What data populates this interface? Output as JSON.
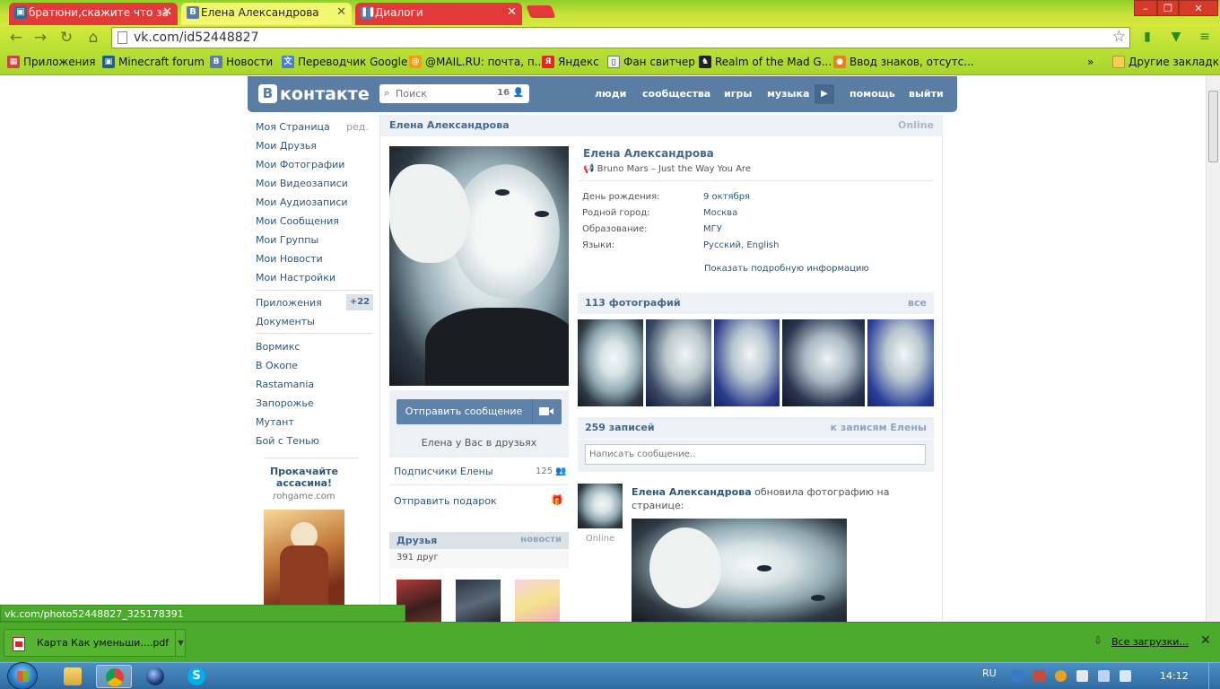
{
  "browser": {
    "tabs": [
      {
        "title": "братюни,скажите что за",
        "active": false
      },
      {
        "title": "Елена Александрова",
        "active": true
      },
      {
        "title": "Диалоги",
        "active": false
      }
    ],
    "url": "vk.com/id52448827",
    "bookmarks": [
      {
        "label": "Приложения",
        "icon": "apps-icon"
      },
      {
        "label": "Minecraft forum",
        "icon": "minecraft-icon"
      },
      {
        "label": "Новости",
        "icon": "vk-icon"
      },
      {
        "label": "Переводчик Google",
        "icon": "translate-icon"
      },
      {
        "label": "@MAIL.RU: почта, п...",
        "icon": "mailru-icon"
      },
      {
        "label": "Яндекс",
        "icon": "yandex-icon"
      },
      {
        "label": "Фан свитчер",
        "icon": "page-icon"
      },
      {
        "label": "Realm of the Mad G...",
        "icon": "realm-icon"
      },
      {
        "label": "Ввод знаков, отсутс...",
        "icon": "apple-icon"
      }
    ],
    "bookmarks_more": "»",
    "other_bookmarks": "Другие закладки",
    "status_url": "vk.com/photo52448827_325178391"
  },
  "vk": {
    "logo": "контакте",
    "logo_letter": "В",
    "search": {
      "placeholder": "Поиск",
      "count": "16"
    },
    "nav": [
      "люди",
      "сообщества",
      "игры",
      "музыка",
      "помощь",
      "выйти"
    ],
    "left_menu": [
      "Моя Страница",
      "Мои Друзья",
      "Мои Фотографии",
      "Мои Видеозаписи",
      "Мои Аудиозаписи",
      "Мои Сообщения",
      "Мои Группы",
      "Мои Новости",
      "Мои Настройки"
    ],
    "edit_label": "ред.",
    "apps_menu": [
      "Приложения",
      "Документы"
    ],
    "apps_badge": "+22",
    "app_links": [
      "Вормикс",
      "В Окопе",
      "Rastamania",
      "Запорожье",
      "Мутант",
      "Бой с Тенью"
    ],
    "ad": {
      "title": "Прокачайте ассасина!",
      "site": "rohgame.com"
    }
  },
  "profile": {
    "name": "Елена Александрова",
    "online": "Online",
    "status_track": "Bruno Mars – Just the Way You Are",
    "info": [
      {
        "label": "День рождения:",
        "value": "9 октября"
      },
      {
        "label": "Родной город:",
        "value": "Москва"
      },
      {
        "label": "Образование:",
        "value": "МГУ"
      },
      {
        "label": "Языки:",
        "value": "Русский, English"
      }
    ],
    "show_more": "Показать подробную информацию",
    "send_message": "Отправить сообщение",
    "friend_status": "Елена у Вас в друзьях",
    "subscribers": {
      "label": "Подписчики Елены",
      "count": "125"
    },
    "gift": "Отправить подарок",
    "friends": {
      "title": "Друзья",
      "link": "новости",
      "count": "391 друг"
    },
    "photos": {
      "title": "113 фотографий",
      "link": "все"
    },
    "wall": {
      "title": "259 записей",
      "link": "к записям Елены",
      "placeholder": "Написать сообщение..",
      "post_author": "Елена Александрова",
      "post_text": "обновила фотографию на странице:",
      "post_online": "Online"
    }
  },
  "downloads": {
    "item": "Карта Как уменьши....pdf",
    "all": "Все загрузки..."
  },
  "taskbar": {
    "lang": "RU",
    "time": "14:12"
  },
  "colors": {
    "vk_header": "#597da3",
    "vk_link": "#2b587a",
    "chrome_theme": "#c9e33a",
    "download_bar": "#4caa2c",
    "tab_inactive": "#e23a3a"
  }
}
